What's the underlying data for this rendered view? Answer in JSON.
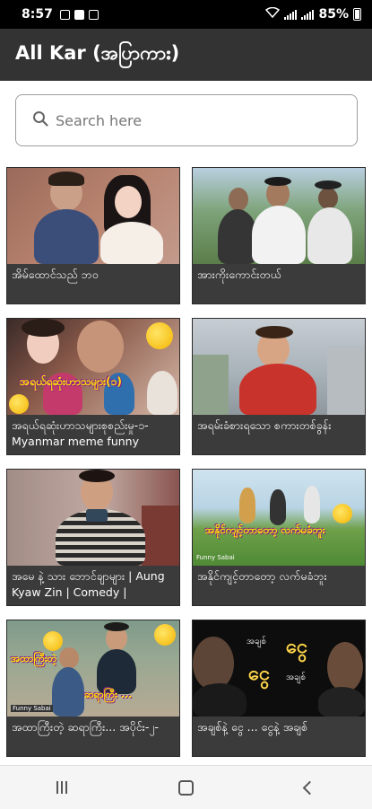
{
  "status_bar": {
    "time": "8:57",
    "battery": "85%"
  },
  "app_bar": {
    "title": "All Kar (အပြာကား)"
  },
  "search": {
    "placeholder": "Search here",
    "value": ""
  },
  "videos": [
    {
      "title": "အိမ်ထောင်သည် ဘဝ"
    },
    {
      "title": "အားကိုးကောင်းတယ်"
    },
    {
      "title": "အရယ်ရဆုံးဟာသများစုစည်းမှု-၁- Myanmar meme funny"
    },
    {
      "title": "အရမ်းခံစားရသော စကားတစ်ခွန်း"
    },
    {
      "title": "အမေ နဲ့ သား ဘောင်ချာများ | Aung Kyaw Zin | Comedy |"
    },
    {
      "title": "အနိုင်ကျင့်တာတော့ လက်မခံဘူး"
    },
    {
      "title": "အထာကြီးတဲ့ ဆရာကြီး... အပိုင်း-၂-"
    },
    {
      "title": "အချစ်နဲ့ ငွေ ... ငွေနဲ့ အချစ်"
    }
  ],
  "thumbnail_text": {
    "t3": "အရယ်ရဆုံးဟာသများ(၁)",
    "t6": "အနိုင်ကျင့်တာတော့ လက်မခံဘူး",
    "t6_brand": "Funny Sabai",
    "t7a": "အထာကြီးတဲ့",
    "t7b": "ဆရာကြီး ...",
    "t7_brand": "Funny Sabai",
    "t8_small1": "အချစ်",
    "t8_big1": "ငွေ",
    "t8_big2": "ငွေ",
    "t8_small2": "အချစ်"
  }
}
